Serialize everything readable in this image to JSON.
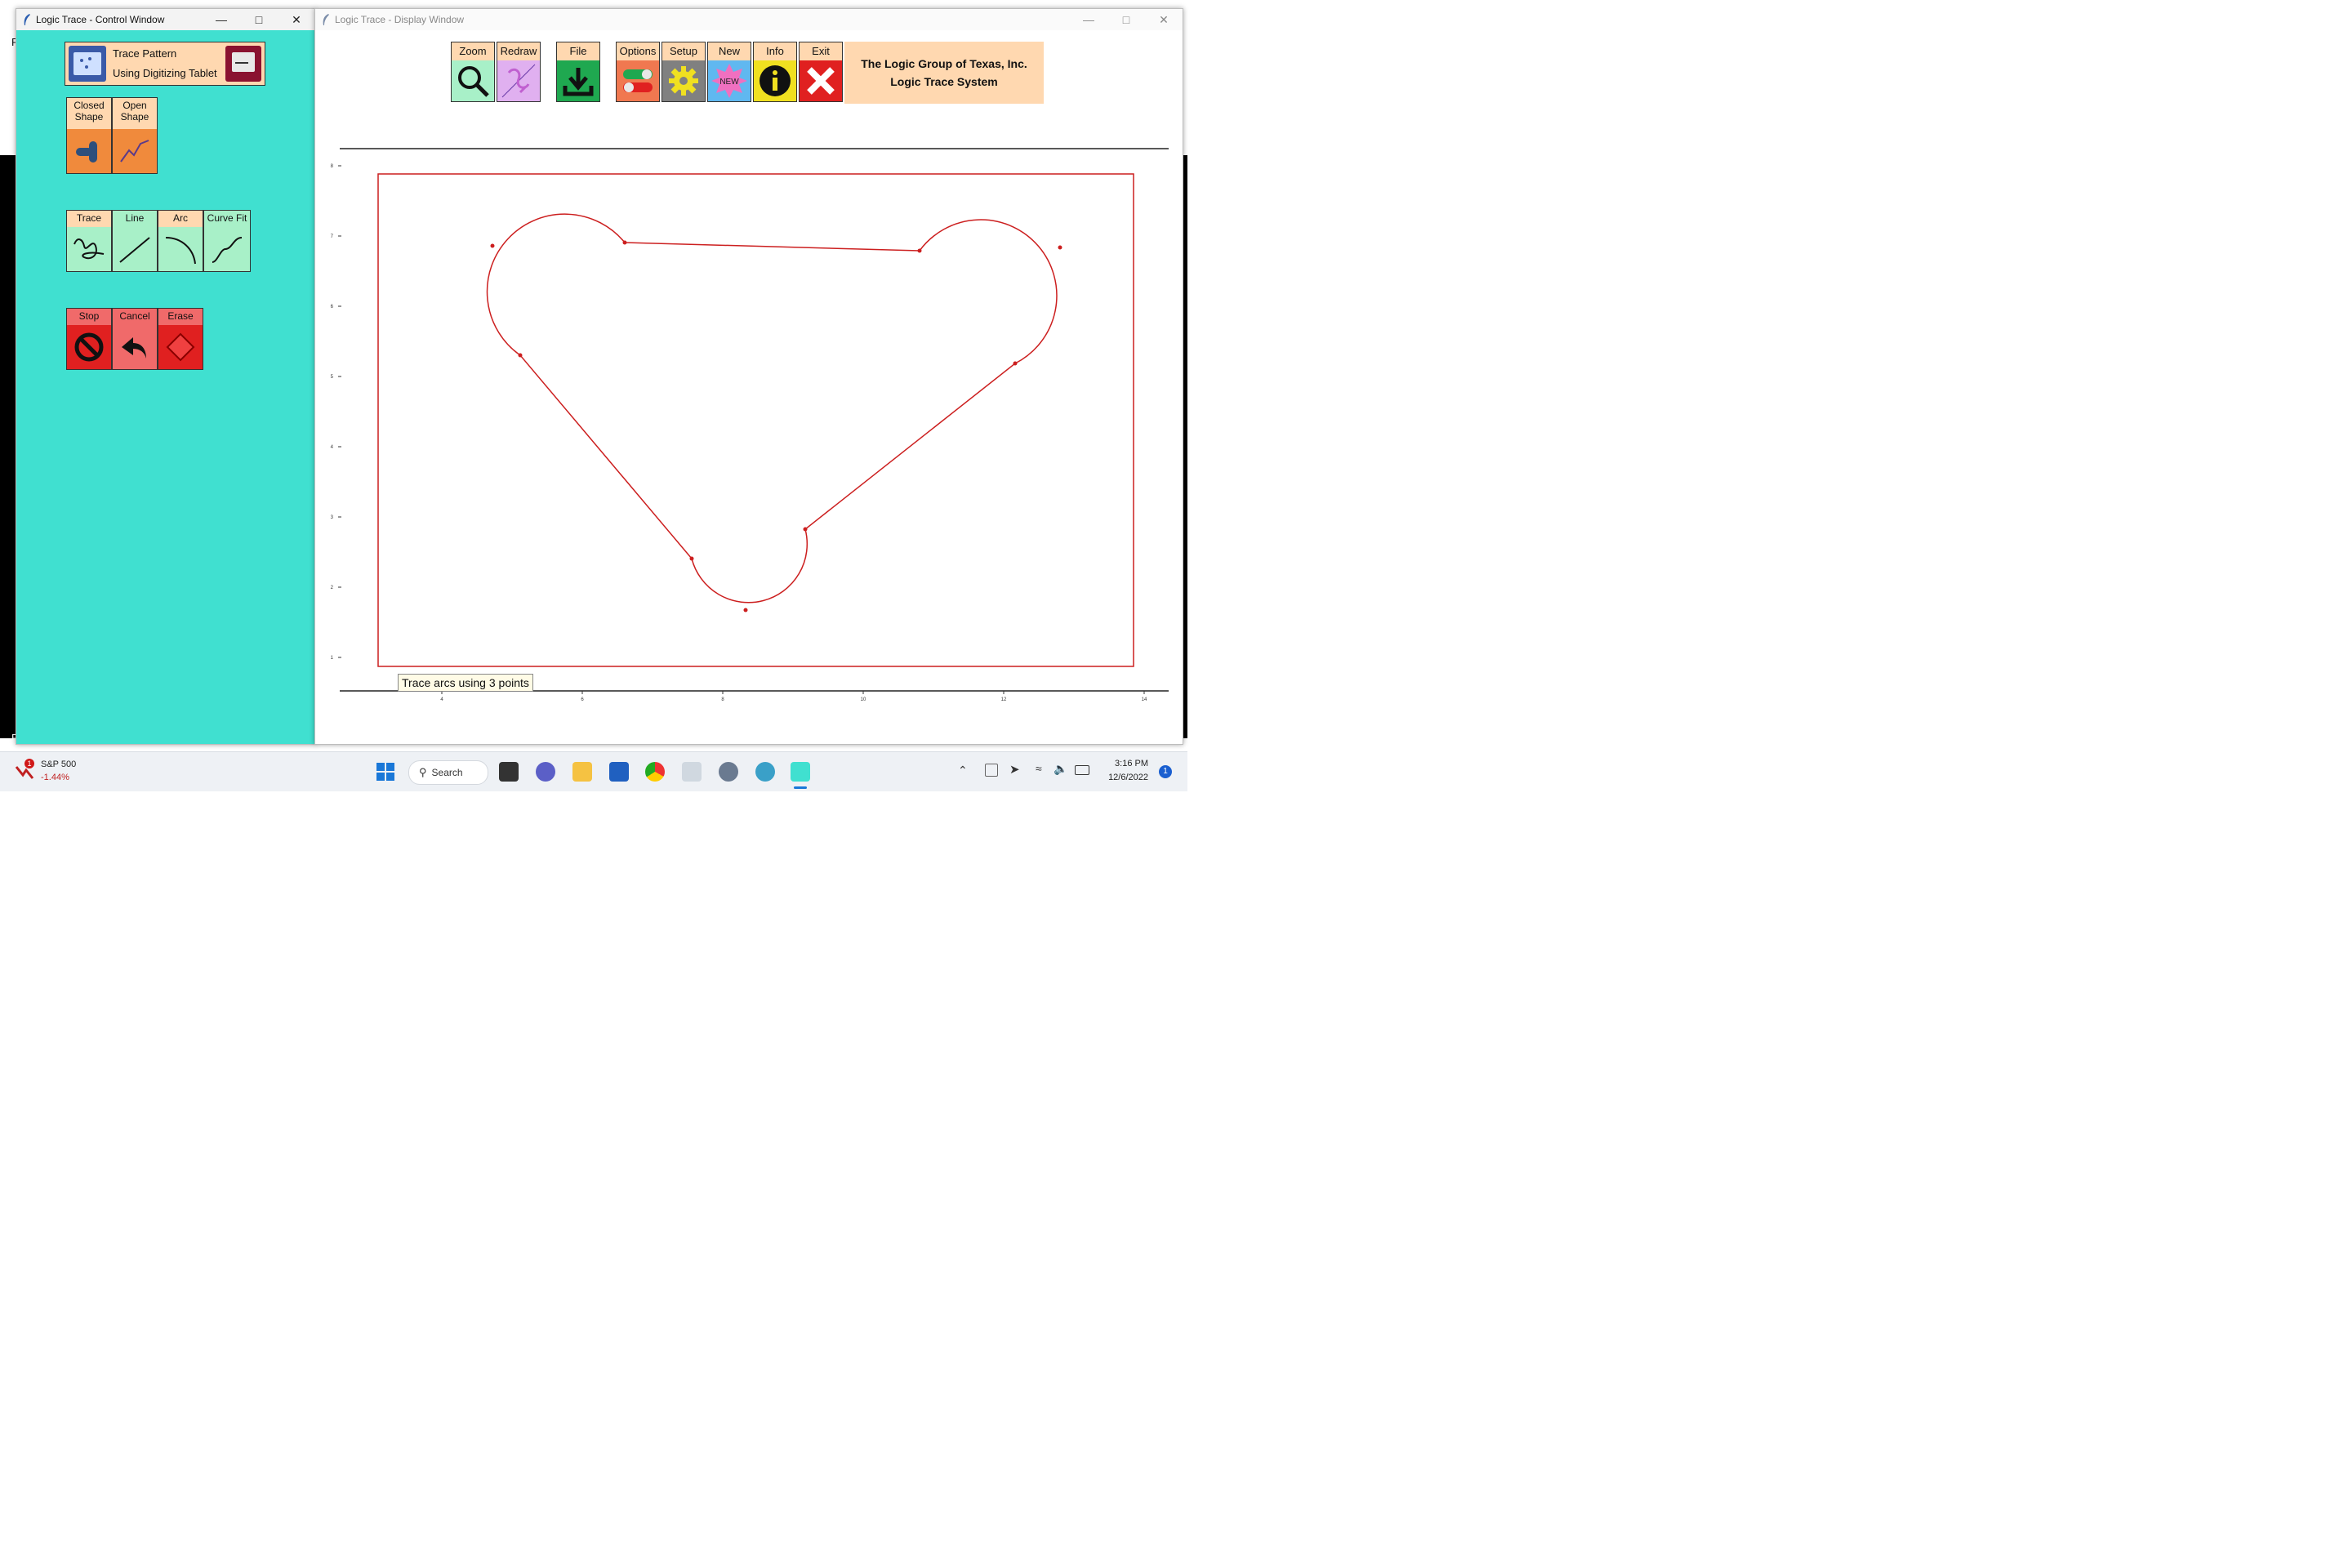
{
  "control_window": {
    "title": "Logic Trace - Control Window",
    "min": "—",
    "max": "□",
    "close": "✕",
    "trace_pattern": {
      "line1": "Trace Pattern",
      "line2": "Using Digitizing Tablet"
    },
    "shape_buttons": [
      {
        "label": "Closed Shape",
        "icon": "closed-shape-icon"
      },
      {
        "label": "Open Shape",
        "icon": "open-shape-icon"
      }
    ],
    "draw_buttons": [
      {
        "label": "Trace",
        "icon": "trace-icon"
      },
      {
        "label": "Line",
        "icon": "line-icon"
      },
      {
        "label": "Arc",
        "icon": "arc-icon"
      },
      {
        "label": "Curve Fit",
        "icon": "curve-fit-icon"
      }
    ],
    "action_buttons": [
      {
        "label": "Stop",
        "icon": "stop-icon"
      },
      {
        "label": "Cancel",
        "icon": "cancel-icon"
      },
      {
        "label": "Erase",
        "icon": "erase-icon"
      }
    ],
    "edge_letters": [
      "F",
      "F"
    ]
  },
  "display_window": {
    "title": "Logic Trace - Display Window",
    "min": "—",
    "max": "□",
    "close": "✕",
    "toolbar": [
      {
        "label": "Zoom",
        "icon": "zoom-icon"
      },
      {
        "label": "Redraw",
        "icon": "redraw-icon"
      },
      {
        "label": "File",
        "icon": "file-download-icon"
      },
      {
        "label": "Options",
        "icon": "options-toggle-icon"
      },
      {
        "label": "Setup",
        "icon": "setup-gear-icon"
      },
      {
        "label": "New",
        "icon": "new-badge-icon",
        "badge": "NEW"
      },
      {
        "label": "Info",
        "icon": "info-icon"
      },
      {
        "label": "Exit",
        "icon": "exit-icon"
      }
    ],
    "company": {
      "line1": "The Logic Group of Texas, Inc.",
      "line2": "Logic Trace System"
    },
    "tooltip": "Trace arcs using 3 points",
    "y_ticks": [
      "8",
      "7",
      "6",
      "5",
      "4",
      "3",
      "2",
      "1"
    ],
    "x_ticks": [
      "4",
      "6",
      "8",
      "10",
      "12",
      "14"
    ],
    "colors": {
      "shape": "#cc1f1f",
      "control_bg": "#40e0d0",
      "peach": "#ffd8b0",
      "mint": "#a8f0c8",
      "salmon": "#f06a6a"
    }
  },
  "taskbar": {
    "stock_name": "S&P 500",
    "stock_change": "-1.44%",
    "stock_badge": "1",
    "search_label": "Search",
    "time": "3:16 PM",
    "date": "12/6/2022",
    "notification_count": "1"
  }
}
